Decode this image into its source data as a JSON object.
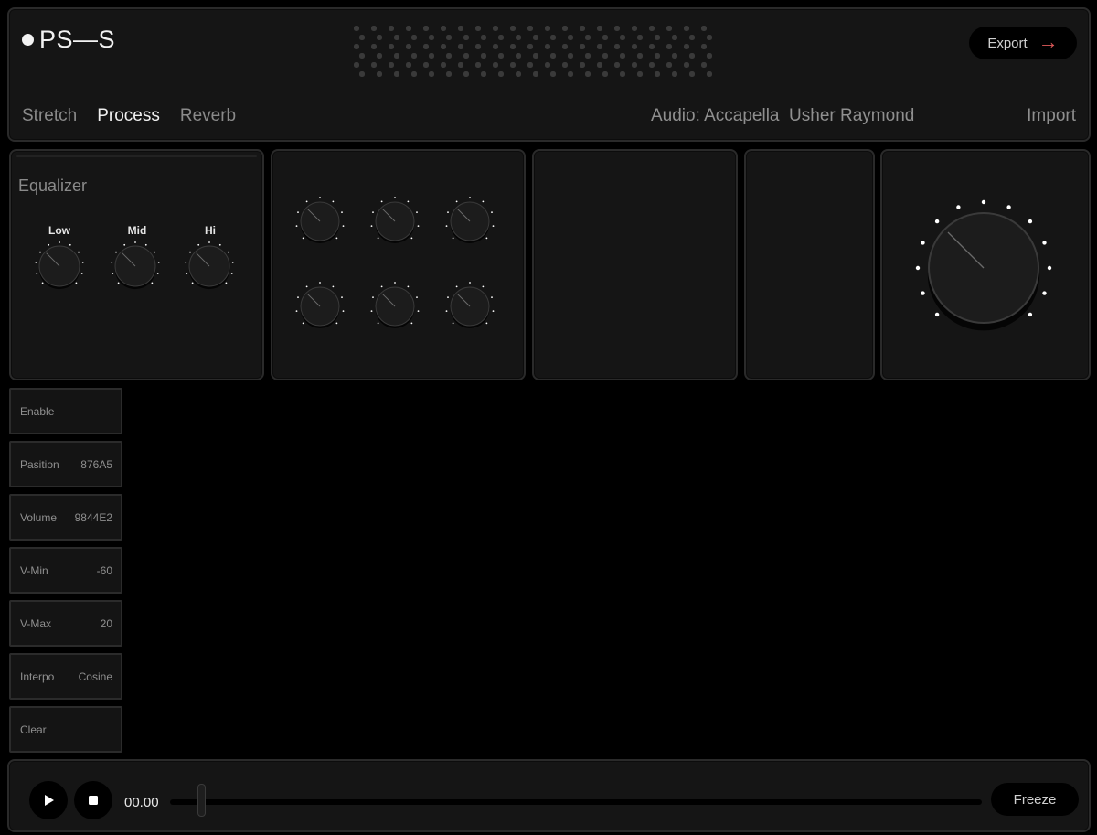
{
  "header": {
    "logo_text": "PS—S",
    "export_label": "Export",
    "export_icon": "arrow-right-icon",
    "tabs": [
      {
        "label": "Stretch",
        "active": false
      },
      {
        "label": "Process",
        "active": true
      },
      {
        "label": "Reverb",
        "active": false
      }
    ],
    "audio_label": "Audio: Accapella  Usher Raymond",
    "import_label": "Import"
  },
  "equalizer": {
    "title": "Equalizer",
    "knobs": [
      {
        "label": "Low"
      },
      {
        "label": "Mid"
      },
      {
        "label": "Hi"
      }
    ]
  },
  "params": [
    {
      "label": "Enable",
      "value": ""
    },
    {
      "label": "Pasition",
      "value": "876A5"
    },
    {
      "label": "Volume",
      "value": "9844E2"
    },
    {
      "label": "V-Min",
      "value": "-60"
    },
    {
      "label": "V-Max",
      "value": "20"
    },
    {
      "label": "Interpo",
      "value": "Cosine"
    },
    {
      "label": "Clear",
      "value": ""
    }
  ],
  "transport": {
    "play_icon": "play-icon",
    "stop_icon": "stop-icon",
    "time": "00.00",
    "position_fraction": 0.0,
    "freeze_label": "Freeze"
  },
  "colors": {
    "background": "#000000",
    "panel": "#151515",
    "accent": "#e05a5a",
    "active_text": "#f0f0f0",
    "muted_text": "#8a8a8a"
  }
}
